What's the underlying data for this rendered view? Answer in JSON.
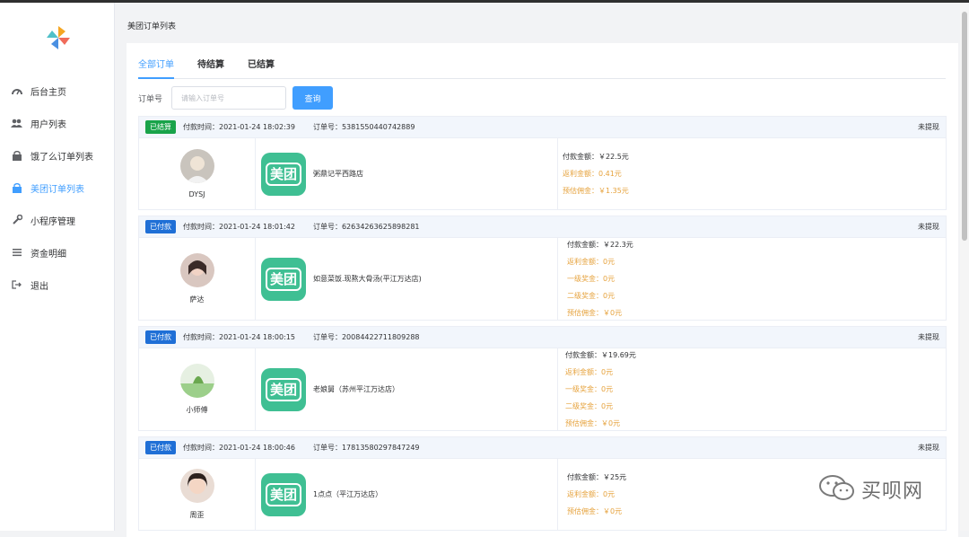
{
  "sidebar": {
    "items": [
      {
        "label": "后台主页",
        "icon": "dashboard-icon",
        "active": false
      },
      {
        "label": "用户列表",
        "icon": "users-icon",
        "active": false
      },
      {
        "label": "饿了么订单列表",
        "icon": "shopping-bag-icon",
        "active": false
      },
      {
        "label": "美团订单列表",
        "icon": "shopping-bag-icon",
        "active": true
      },
      {
        "label": "小程序管理",
        "icon": "wrench-icon",
        "active": false
      },
      {
        "label": "资金明细",
        "icon": "list-icon",
        "active": false
      },
      {
        "label": "退出",
        "icon": "logout-icon",
        "active": false
      }
    ]
  },
  "breadcrumb": "美团订单列表",
  "tabs": [
    {
      "label": "全部订单",
      "active": true
    },
    {
      "label": "待结算",
      "active": false
    },
    {
      "label": "已结算",
      "active": false
    }
  ],
  "search": {
    "label": "订单号",
    "placeholder": "请输入订单号",
    "button": "查询"
  },
  "orders": [
    {
      "status": "已结算",
      "status_type": "settled",
      "time": "付款时间：2021-01-24 18:02:39",
      "order_no": "订单号：5381550440742889",
      "withdraw": "未提现",
      "user": "DYSJ",
      "logo_text": "美团",
      "shop": "粥鼎记平西路店",
      "money": {
        "pay": "付款金额：￥22.5元",
        "lines": [
          "返利金额：0.41元",
          "预估佣金：￥1.35元"
        ]
      }
    },
    {
      "status": "已付款",
      "status_type": "paid",
      "time": "付款时间：2021-01-24 18:01:42",
      "order_no": "订单号：62634263625898281",
      "withdraw": "未提现",
      "user": "萨达",
      "logo_text": "美团",
      "shop": "如意菜饭.现熬大骨汤(平江万达店)",
      "money": {
        "pay": "付款金额：￥22.3元",
        "lines": [
          "返利金额：0元",
          "一级奖金：0元",
          "二级奖金：0元",
          "预估佣金：￥0元"
        ]
      }
    },
    {
      "status": "已付款",
      "status_type": "paid",
      "time": "付款时间：2021-01-24 18:00:15",
      "order_no": "订单号：20084422711809288",
      "withdraw": "未提现",
      "user": "小师傅",
      "logo_text": "美团",
      "shop": "老娘舅（苏州平江万达店）",
      "money": {
        "pay": "付款金额：￥19.69元",
        "lines": [
          "返利金额：0元",
          "一级奖金：0元",
          "二级奖金：0元",
          "预估佣金：￥0元"
        ]
      }
    },
    {
      "status": "已付款",
      "status_type": "paid",
      "time": "付款时间：2021-01-24 18:00:46",
      "order_no": "订单号：17813580297847249",
      "withdraw": "未提现",
      "user": "周歪",
      "logo_text": "美团",
      "shop": "1点点（平江万达店）",
      "money": {
        "pay": "付款金额：￥25元",
        "lines": [
          "返利金额：0元",
          "预估佣金：￥0元"
        ]
      }
    }
  ],
  "watermark": "买呗网",
  "colors": {
    "accent": "#409eff",
    "settled": "#19a34a",
    "paid": "#1f6fd6",
    "orange": "#e6a23c",
    "meituan": "#3fbf93"
  }
}
